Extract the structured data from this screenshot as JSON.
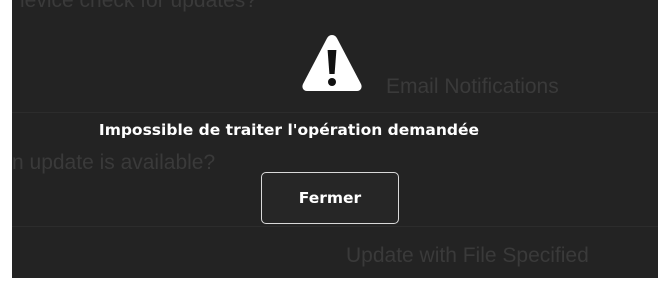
{
  "background": {
    "line_1": "levice check for updates?",
    "line_2": "Email Notifications",
    "line_3": "n update is available?",
    "line_4": "Update with File Specified"
  },
  "dialog": {
    "icon": "warning-icon",
    "message": "Impossible de traiter l'opération demandée",
    "close_label": "Fermer"
  },
  "colors": {
    "overlay": "#232323",
    "dialog_text": "#ffffff",
    "button_border": "#d9d9d9"
  }
}
